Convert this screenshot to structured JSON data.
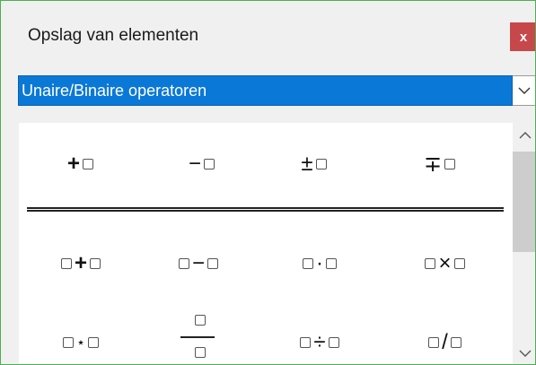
{
  "window": {
    "title": "Opslag van elementen",
    "close_label": "x"
  },
  "category_select": {
    "value": "Unaire/Binaire operatoren"
  },
  "icons": {
    "close": "close-icon",
    "dropdown": "chevron-down-icon",
    "scroll_up": "chevron-up-icon",
    "scroll_down": "chevron-down-icon"
  },
  "colors": {
    "selection": "#0a78d7",
    "close": "#c6484b",
    "border": "#4caf50"
  },
  "symbols": {
    "unary": [
      {
        "name": "plus",
        "op": "+",
        "box_before": false
      },
      {
        "name": "minus",
        "op": "−",
        "box_before": false
      },
      {
        "name": "plus-minus",
        "op": "±",
        "box_before": false
      },
      {
        "name": "minus-plus",
        "op": "∓",
        "box_before": false
      }
    ],
    "binary": [
      {
        "name": "addition",
        "op": "+"
      },
      {
        "name": "subtraction",
        "op": "−"
      },
      {
        "name": "cdot",
        "op": "·"
      },
      {
        "name": "times",
        "op": "×"
      }
    ],
    "third": [
      {
        "name": "star",
        "op": "⋆"
      },
      {
        "name": "fraction",
        "op": ""
      },
      {
        "name": "division",
        "op": "÷"
      },
      {
        "name": "slash",
        "op": "/"
      }
    ]
  }
}
